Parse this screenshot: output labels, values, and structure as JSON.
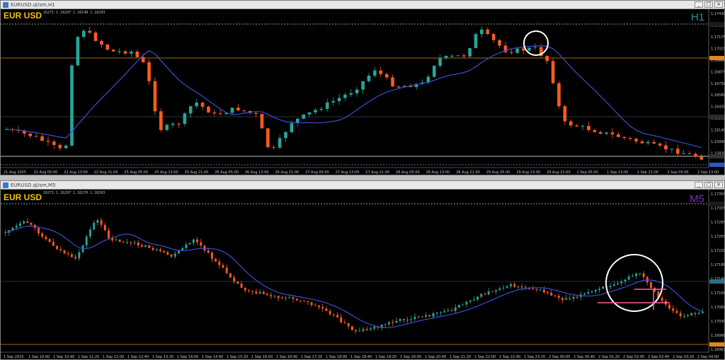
{
  "colors": {
    "bull": "#26a69a",
    "bear": "#ff5a1f",
    "ma": "#3b4fd0",
    "price_line": "#d98a1a",
    "level": "#ffffff",
    "cur": "#2a6f8a"
  },
  "top": {
    "title": "EURUSD.ql/sm,H1",
    "symbol": "EUR USD",
    "ohlc": "16271 1.16297 1.16148 1.16293",
    "timeframe": "H1",
    "tf_color": "#2a8fa6",
    "y_labels": [
      "1.17430",
      "1.17350",
      "1.17175",
      "1.17025",
      "1.16960",
      "1.16879",
      "1.16730",
      "1.16580",
      "1.16430",
      "1.16293",
      "1.16140",
      "1.15990",
      "1.15830",
      "1.15720"
    ],
    "x_labels": [
      "21 Aug 2025",
      "22 Aug 05:00",
      "22 Aug 13:00",
      "22 Aug 21:00",
      "25 Aug 05:00",
      "25 Aug 13:00",
      "25 Aug 21:00",
      "26 Aug 05:00",
      "26 Aug 13:00",
      "26 Aug 21:00",
      "27 Aug 05:00",
      "27 Aug 13:00",
      "27 Aug 21:00",
      "28 Aug 05:00",
      "28 Aug 13:00",
      "28 Aug 21:00",
      "29 Aug 05:00",
      "29 Aug 13:00",
      "29 Aug 21:00",
      "1 Sep 05:00",
      "1 Sep 13:00",
      "1 Sep 21:00",
      "2 Sep 05:00",
      "2 Sep 13:00"
    ]
  },
  "bottom": {
    "title": "EURUSD.ql/sm,M5",
    "symbol": "EUR USD",
    "ohlc": "16271 1.16297 1.16270 1.16293",
    "timeframe": "M5",
    "tf_color": "#7a2fb8",
    "y_labels": [
      "1.17350",
      "1.17335",
      "1.17295",
      "1.17255",
      "1.17220",
      "1.17180",
      "1.17140",
      "1.17100",
      "1.17060",
      "1.17030",
      "1.16990",
      "1.16963"
    ],
    "x_labels": [
      "1 Sep 2025",
      "1 Sep 10:00",
      "1 Sep 10:40",
      "1 Sep 11:20",
      "1 Sep 12:00",
      "1 Sep 12:40",
      "1 Sep 13:20",
      "1 Sep 14:00",
      "1 Sep 14:40",
      "1 Sep 15:20",
      "1 Sep 16:00",
      "1 Sep 16:40",
      "1 Sep 17:20",
      "1 Sep 18:00",
      "1 Sep 18:40",
      "1 Sep 19:20",
      "1 Sep 20:00",
      "1 Sep 20:40",
      "1 Sep 21:20",
      "1 Sep 22:00",
      "1 Sep 22:40",
      "1 Sep 23:20",
      "2 Sep 00:00",
      "2 Sep 00:40",
      "2 Sep 01:20",
      "2 Sep 02:00",
      "2 Sep 02:40",
      "2 Sep 03:20",
      "2 Sep 04:00"
    ]
  }
}
